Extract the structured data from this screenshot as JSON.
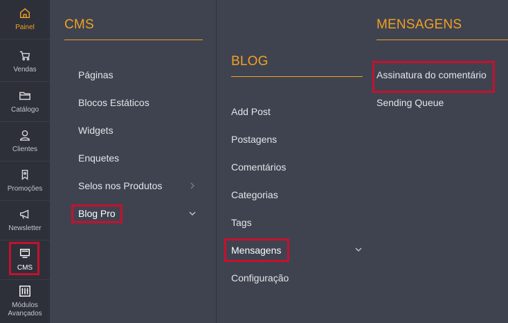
{
  "rail": {
    "items": [
      {
        "label": "Painel",
        "icon": "home-icon"
      },
      {
        "label": "Vendas",
        "icon": "cart-icon"
      },
      {
        "label": "Catálogo",
        "icon": "folder-icon"
      },
      {
        "label": "Clientes",
        "icon": "user-icon"
      },
      {
        "label": "Promoções",
        "icon": "tag-icon"
      },
      {
        "label": "Newsletter",
        "icon": "megaphone-icon"
      },
      {
        "label": "CMS",
        "icon": "monitor-icon"
      },
      {
        "label": "Módulos",
        "label2": "Avançados",
        "icon": "sliders-icon"
      }
    ]
  },
  "cms": {
    "title": "CMS",
    "items": [
      "Páginas",
      "Blocos Estáticos",
      "Widgets",
      "Enquetes",
      "Selos nos Produtos",
      "Blog Pro"
    ]
  },
  "blog": {
    "title": "BLOG",
    "items": [
      "Add Post",
      "Postagens",
      "Comentários",
      "Categorias",
      "Tags",
      "Mensagens",
      "Configuração"
    ]
  },
  "mensagens": {
    "title": "MENSAGENS",
    "items": [
      "Assinatura do comentário",
      "Sending Queue"
    ]
  },
  "colors": {
    "accent": "#f0a023",
    "highlight": "#c8102e",
    "rail_bg": "#2d3039",
    "panel_bg": "#3f4350"
  }
}
